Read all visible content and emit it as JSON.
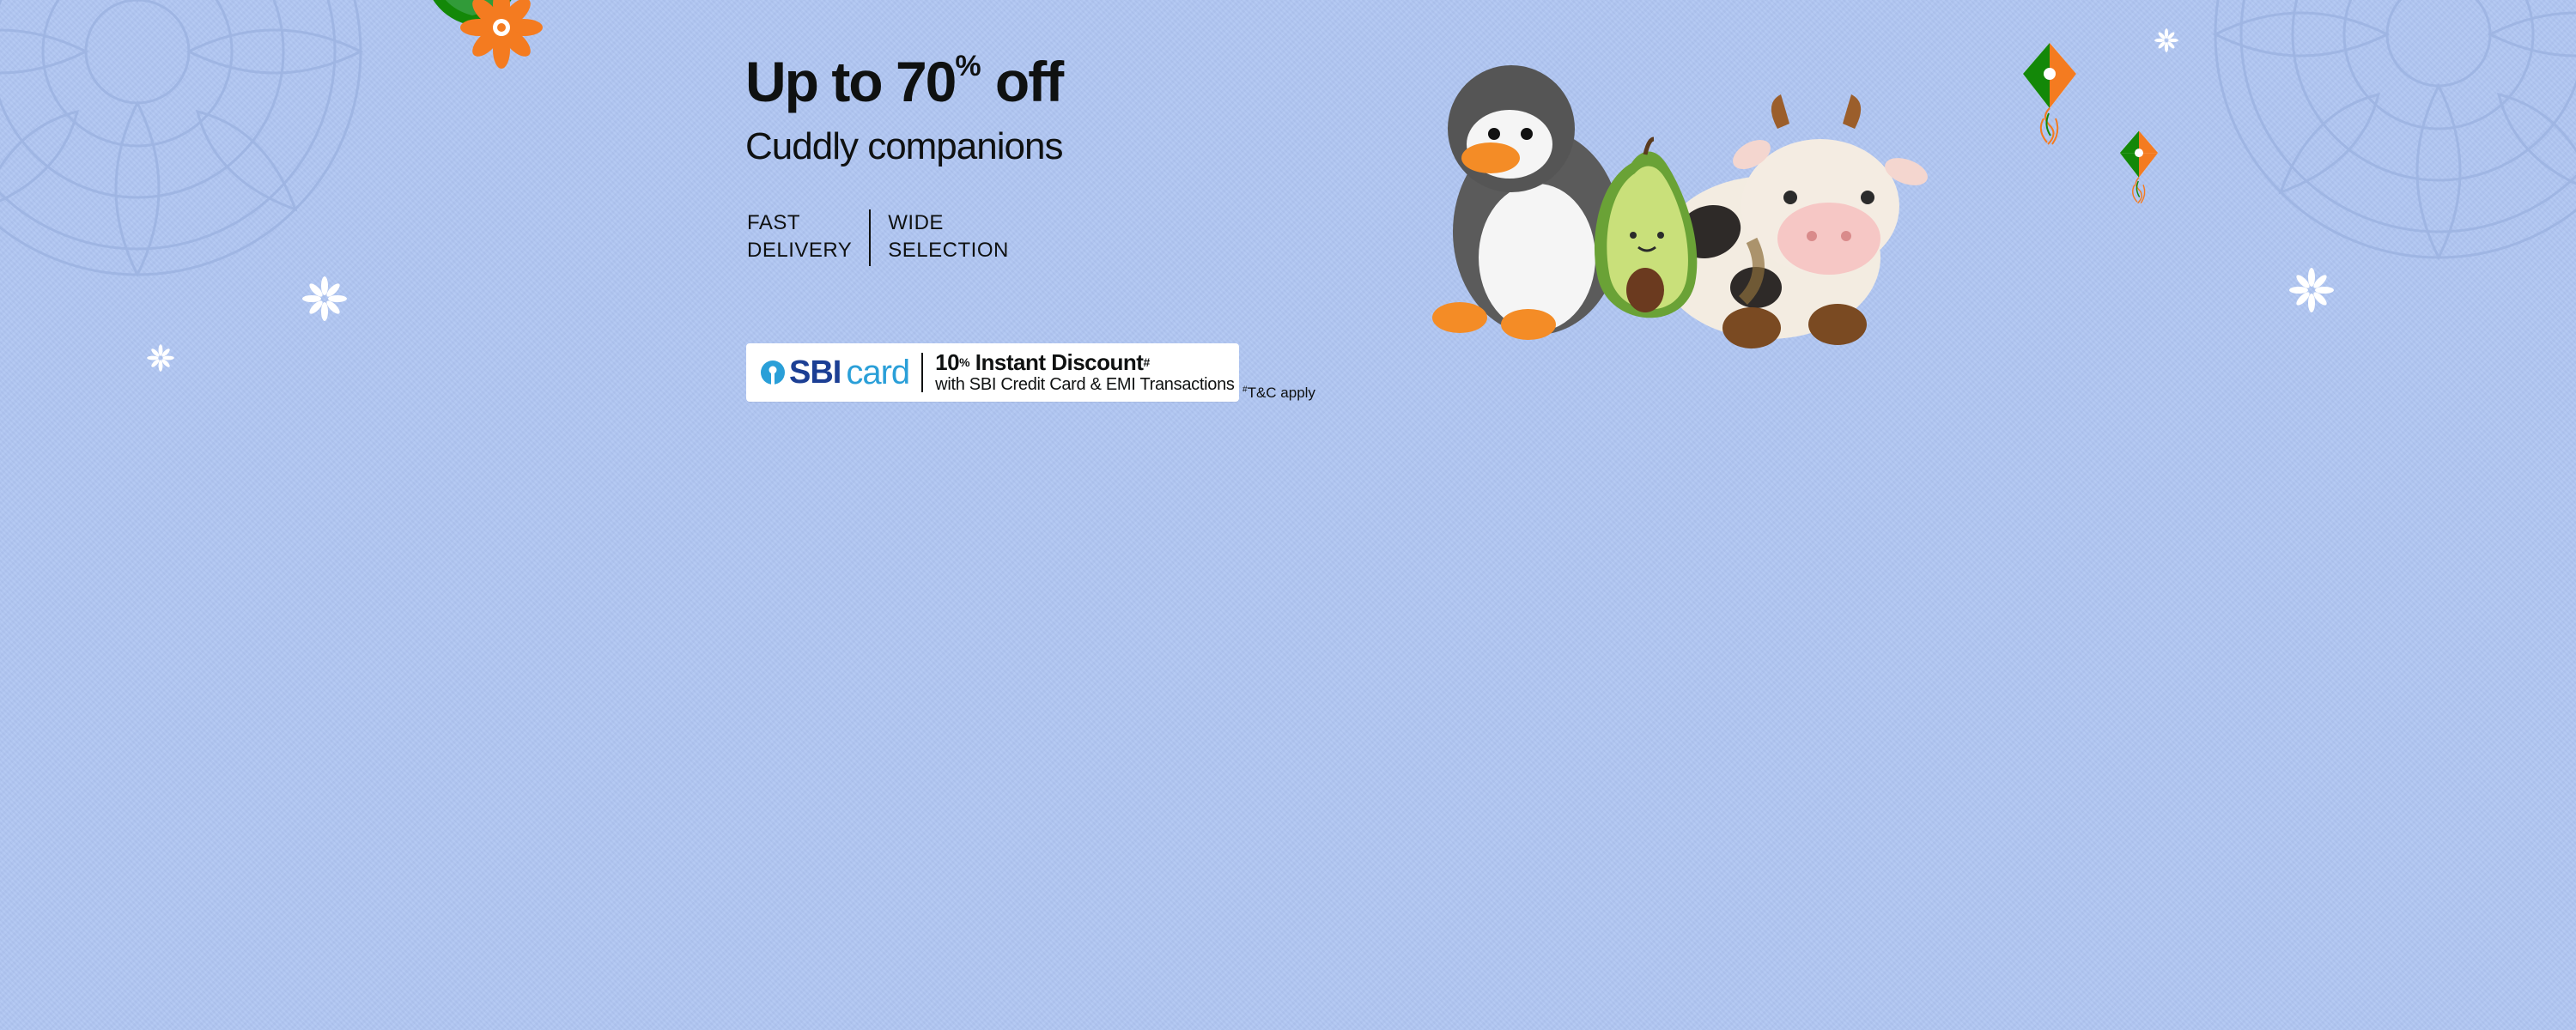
{
  "banner": {
    "headline_pre": "Up to 70",
    "headline_pct": "%",
    "headline_post": " off",
    "subheadline": "Cuddly companions",
    "features": [
      {
        "label": "FAST\nDELIVERY"
      },
      {
        "label": "WIDE\nSELECTION"
      }
    ]
  },
  "offer": {
    "bank_name": "SBI",
    "bank_product": "card",
    "title_pre": "10",
    "title_pct": "%",
    "title_post": " Instant Discount",
    "title_mark": "#",
    "subtitle": "with SBI Credit Card & EMI Transactions",
    "tnc_mark": "#",
    "tnc_text": "T&C apply"
  },
  "colors": {
    "background": "#b0c6f3",
    "text": "#0f1111",
    "sbi_blue": "#1c3f94",
    "card_blue": "#2a9fd8",
    "saffron": "#f47b20",
    "green": "#138808"
  },
  "icons": {
    "sbi_logo": "sbi-logo-icon",
    "toys": "plush-toys-illustration",
    "kite": "kite-icon",
    "flower": "flower-icon",
    "sparkle": "sparkle-icon"
  }
}
